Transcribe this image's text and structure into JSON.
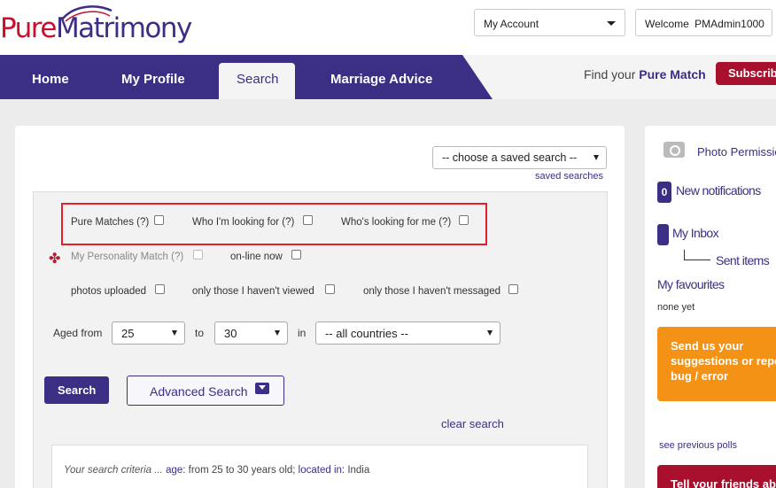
{
  "logo": {
    "part1": "Pure",
    "part2": "Matrimony"
  },
  "header": {
    "account_label": "My Account",
    "welcome_label": "Welcome",
    "username": "PMAdmin1000"
  },
  "nav": {
    "items": [
      "Home",
      "My Profile",
      "Search",
      "Marriage Advice"
    ],
    "active": "Search",
    "find_prefix": "Find your ",
    "find_emph": "Pure Match",
    "subscribe": "Subscribe"
  },
  "search": {
    "saved_select": "-- choose a saved search --",
    "saved_link": "saved searches",
    "filters": {
      "pure_matches": "Pure Matches (?)",
      "who_im_looking_for": "Who I'm looking for (?)",
      "whos_looking_for_me": "Who's looking for me (?)",
      "personality_match": "My Personality Match (?)",
      "online_now": "on-line now",
      "photos_uploaded": "photos uploaded",
      "not_viewed": "only those I haven't viewed",
      "not_messaged": "only those I haven't messaged"
    },
    "aged_from_label": "Aged from",
    "age_from": "25",
    "to_label": "to",
    "age_to": "30",
    "in_label": "in",
    "country": "-- all countries --",
    "search_button": "Search",
    "advanced_button": "Advanced Search",
    "clear_link": "clear search",
    "criteria_prefix": "Your search criteria ...",
    "criteria_age_key": "age:",
    "criteria_age_val": "from 25 to 30 years old;",
    "criteria_loc_key": "located in:",
    "criteria_loc_val": "India"
  },
  "sidebar": {
    "photo_permissions": "Photo Permissions",
    "notifications_count": "0",
    "notifications_label": "New notifications",
    "inbox": "My Inbox",
    "sent": "Sent items",
    "favourites": "My favourites",
    "favourites_status": "none yet",
    "suggest_line1": "Send us your",
    "suggest_line2": "suggestions or report a",
    "suggest_line3": "bug / error",
    "polls": "see previous polls",
    "tell_friends": "Tell your friends about us"
  },
  "colors": {
    "brand_purple": "#3b2f85",
    "brand_red": "#a8102e",
    "orange": "#f39214",
    "highlight": "#e0202a"
  }
}
